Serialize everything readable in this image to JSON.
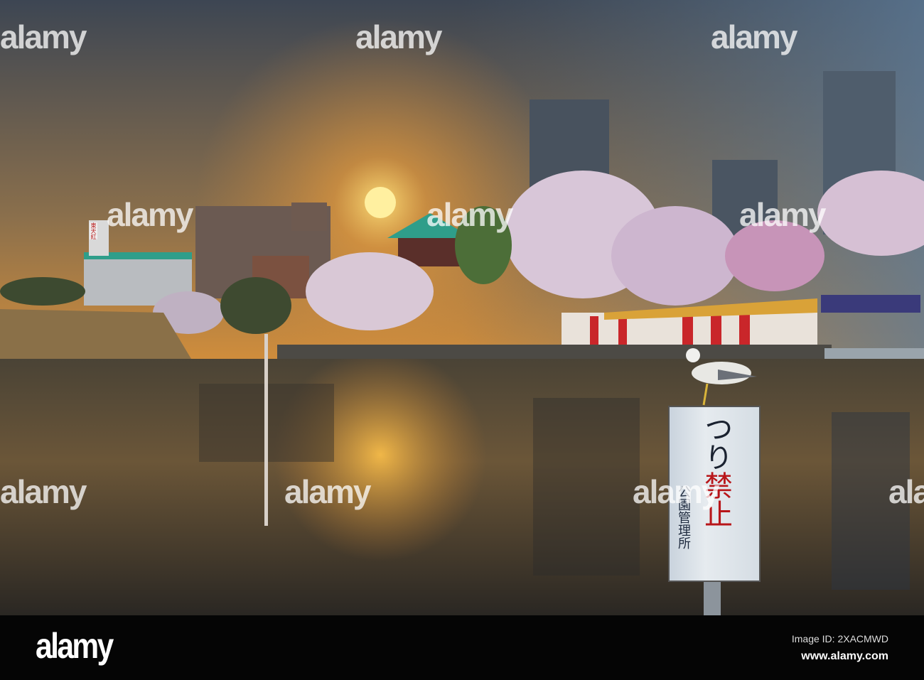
{
  "photo": {
    "subject": "Sunset over Shinobazu Pond, Ueno",
    "sign": {
      "text_black": "つり",
      "text_red": "禁止",
      "text_small": "公園管理所"
    },
    "building_sign": "東天紅",
    "colors": {
      "sky_top": "#3b4a5c",
      "sun": "#ffd23a",
      "sky_glow": "#e39a3c",
      "water": "#2e2a24",
      "blossom": "#e6d4e6",
      "roof": "#2f9e8a"
    }
  },
  "watermarks": [
    "alamy",
    "alamy",
    "alamy",
    "alamy",
    "alamy",
    "alamy",
    "alamy",
    "alamy",
    "alamy",
    "alamy"
  ],
  "footer": {
    "logo": "alamy",
    "image_id": "Image ID: 2XACMWD",
    "website": "www.alamy.com"
  }
}
